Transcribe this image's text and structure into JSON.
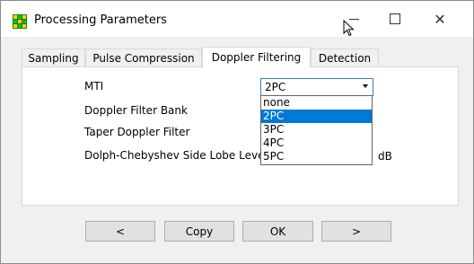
{
  "window": {
    "title": "Processing Parameters",
    "controls": {
      "minimize": "—",
      "maximize": "☐",
      "close": "✕"
    }
  },
  "tabs": [
    {
      "label": "Sampling",
      "active": false
    },
    {
      "label": "Pulse Compression",
      "active": false
    },
    {
      "label": "Doppler Filtering",
      "active": true
    },
    {
      "label": "Detection",
      "active": false
    }
  ],
  "form": {
    "mti_label": "MTI",
    "filter_bank_label": "Doppler Filter Bank",
    "taper_label": "Taper Doppler Filter",
    "dolph_label": "Dolph-Chebyshev Side Lobe Level",
    "dolph_unit": "dB",
    "mti_value": "2PC"
  },
  "dropdown": {
    "options": [
      "none",
      "2PC",
      "3PC",
      "4PC",
      "5PC"
    ],
    "selected": "2PC",
    "highlight_color": "#0078d7"
  },
  "buttons": {
    "prev": "<",
    "copy": "Copy",
    "ok": "OK",
    "next": ">"
  }
}
